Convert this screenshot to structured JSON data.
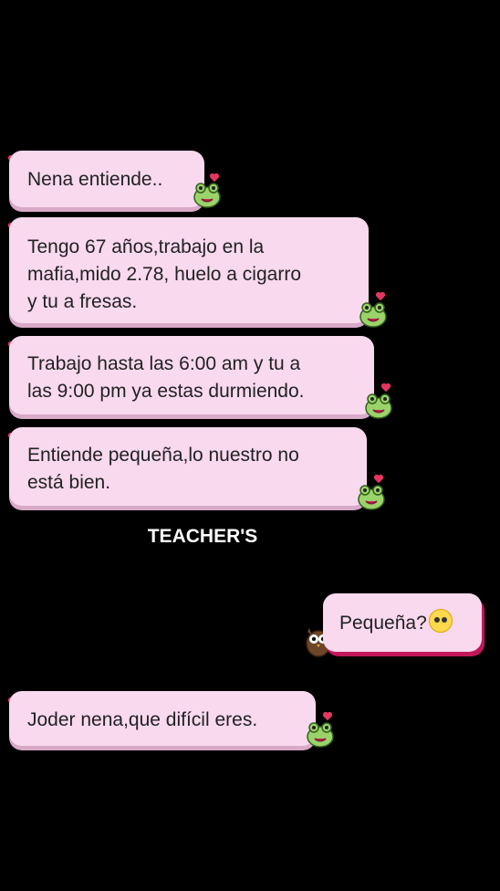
{
  "chat": {
    "messages_left": [
      {
        "lines": [
          "Nena entiende.."
        ]
      },
      {
        "lines": [
          "Tengo 67 años,trabajo en la",
          "mafia,mido 2.78, huelo a cigarro",
          "y tu a fresas."
        ]
      },
      {
        "lines": [
          "Trabajo hasta las 6:00 am y tu a",
          "las 9:00 pm ya estas durmiendo."
        ]
      },
      {
        "lines": [
          "Entiende pequeña,lo nuestro no",
          "está bien."
        ]
      },
      {
        "lines": [
          "Joder nena,que difícil eres."
        ]
      }
    ],
    "sender_label": "TEACHER'S",
    "message_right": "Pequeña?",
    "message_right_emoji": "pleading-face-emoji"
  },
  "colors": {
    "bubble": "#f8d9ee",
    "background": "#000000",
    "heart": "#e2375f"
  }
}
